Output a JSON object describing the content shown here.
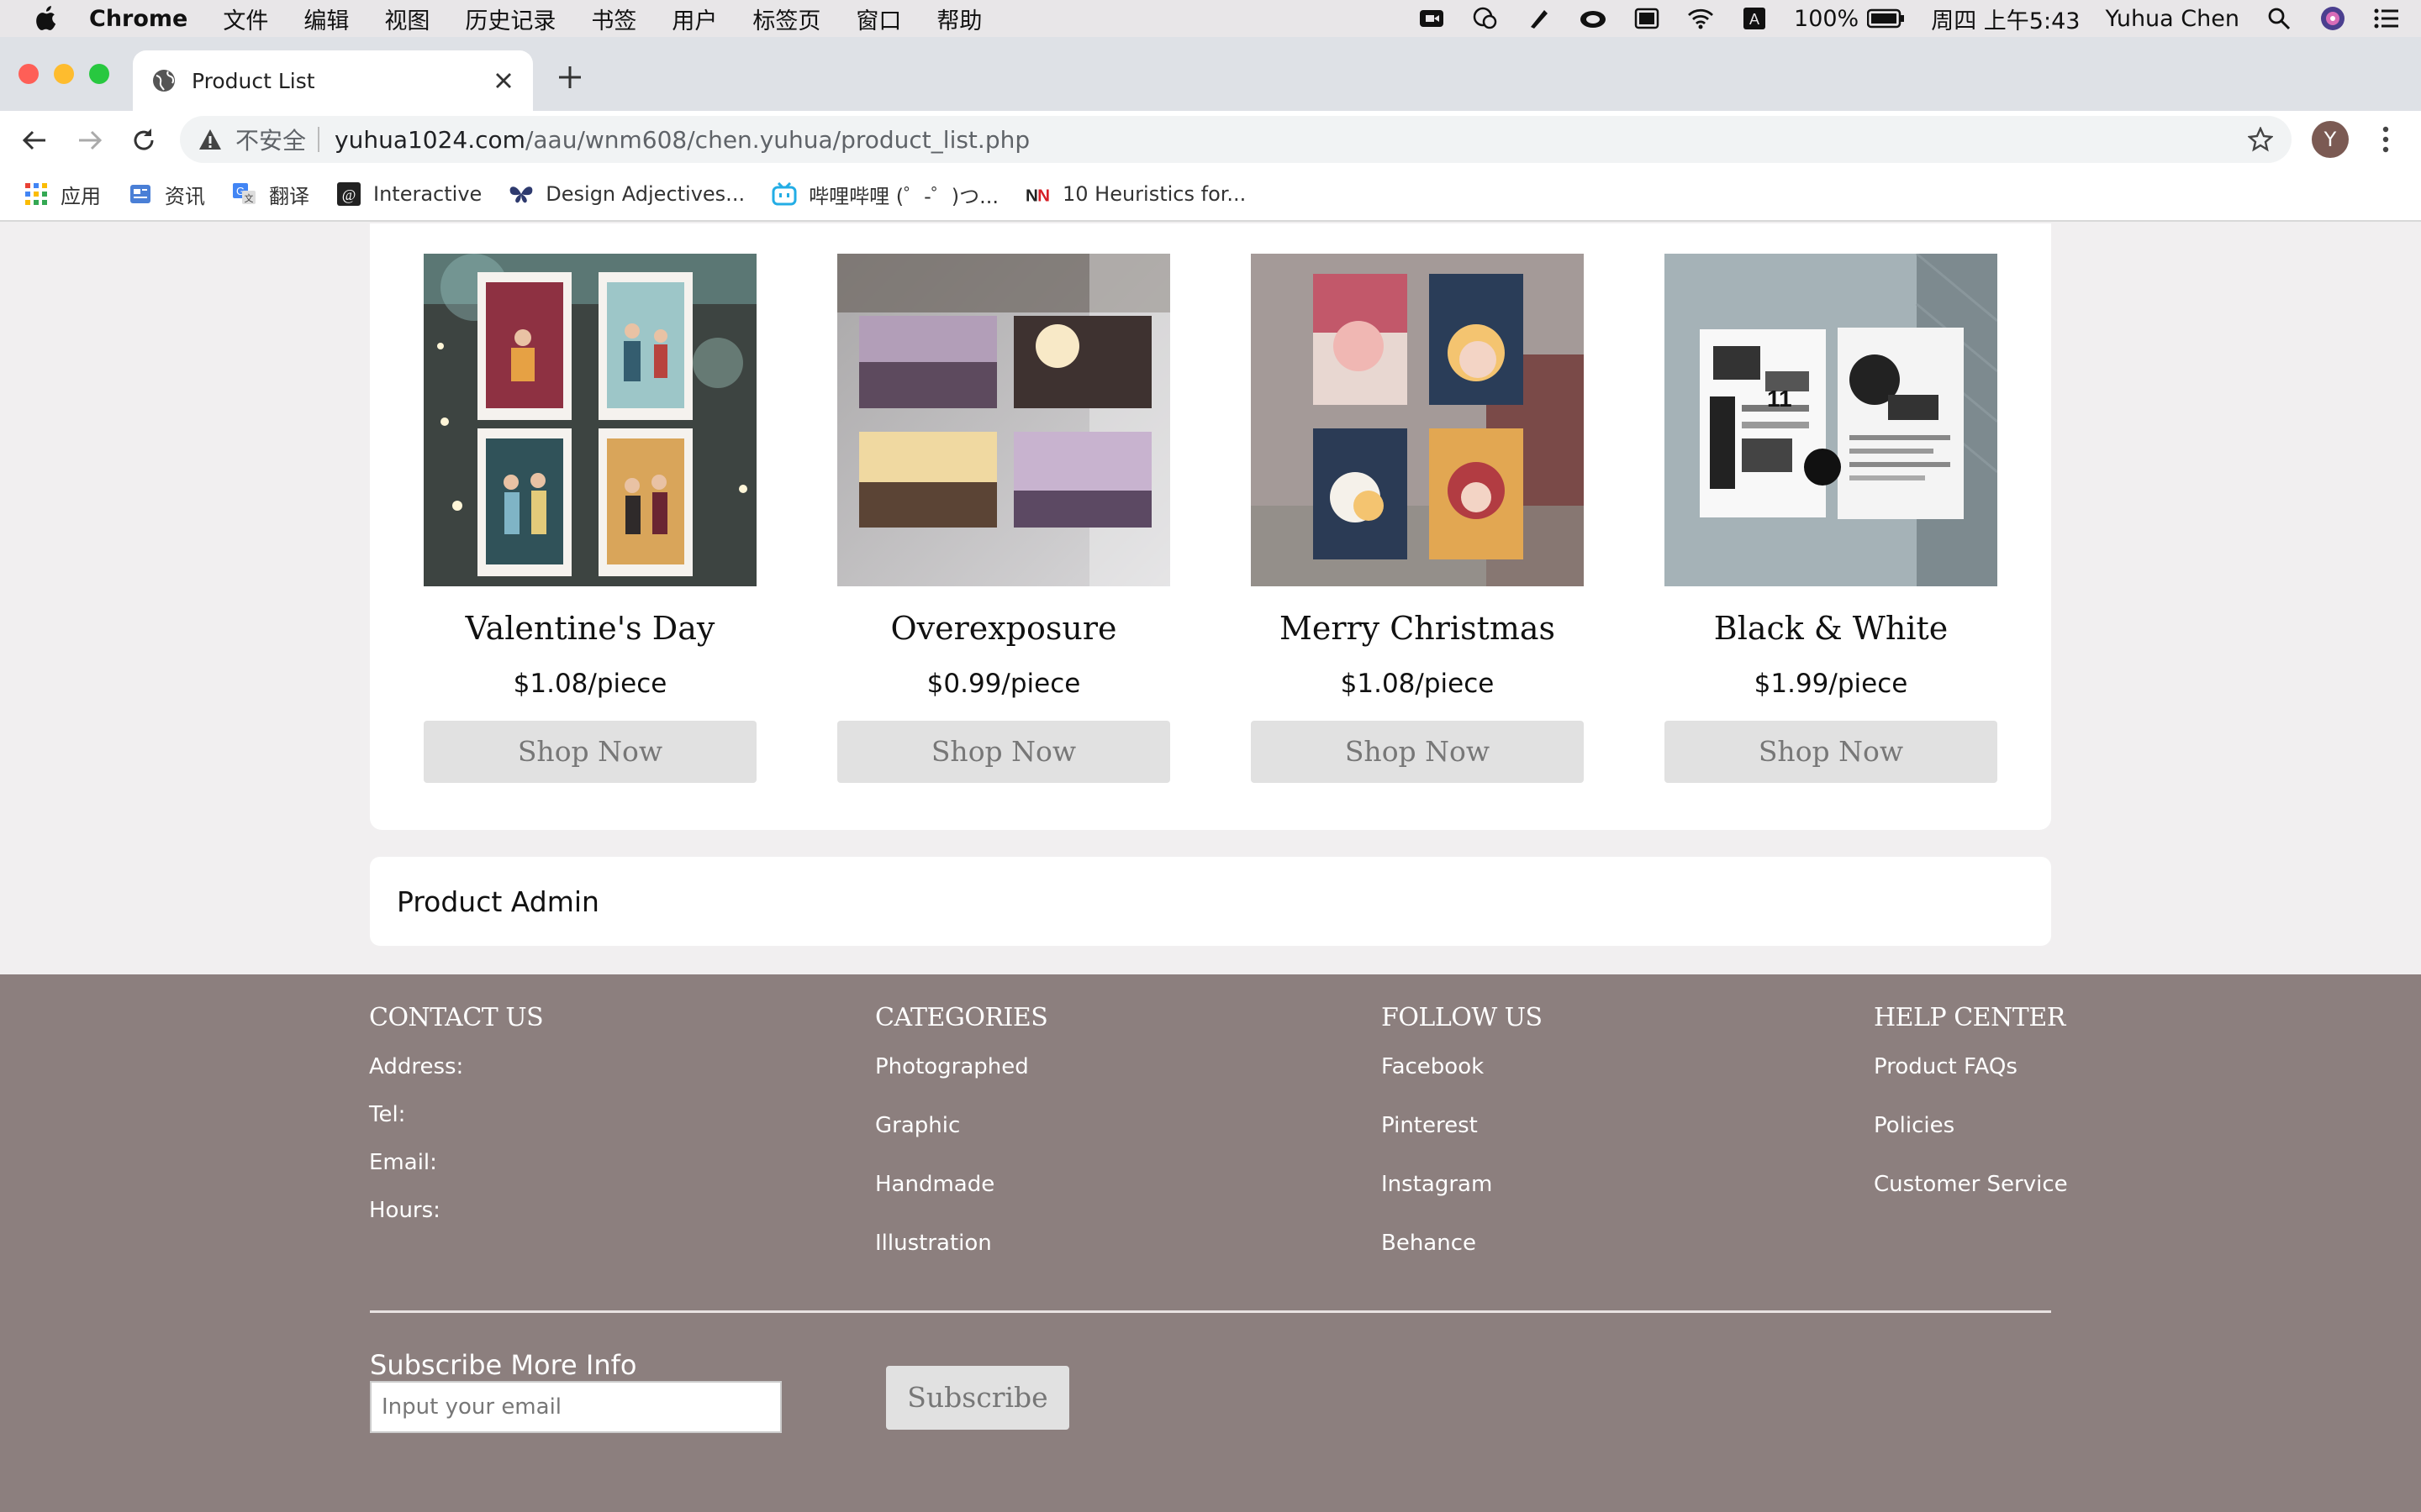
{
  "menubar": {
    "app": "Chrome",
    "items": [
      "文件",
      "编辑",
      "视图",
      "历史记录",
      "书签",
      "用户",
      "标签页",
      "窗口",
      "帮助"
    ],
    "battery": "100%",
    "datetime": "周四 上午5:43",
    "user": "Yuhua Chen"
  },
  "tab": {
    "title": "Product List"
  },
  "omnibox": {
    "insecure_label": "不安全",
    "host": "yuhua1024.com",
    "path": "/aau/wnm608/chen.yuhua/product_list.php"
  },
  "profile": {
    "initial": "Y"
  },
  "bookmarks": [
    {
      "label": "应用",
      "icon": "apps-grid-icon"
    },
    {
      "label": "资讯",
      "icon": "news-icon"
    },
    {
      "label": "翻译",
      "icon": "translate-icon"
    },
    {
      "label": "Interactive",
      "icon": "interactive-icon"
    },
    {
      "label": "Design Adjectives...",
      "icon": "butterfly-icon"
    },
    {
      "label": "哔哩哔哩 (゜-゜)つ...",
      "icon": "bilibili-icon"
    },
    {
      "label": "10 Heuristics for...",
      "icon": "nn-icon"
    }
  ],
  "products": [
    {
      "name": "Valentine's Day",
      "price": "$1.08/piece",
      "button": "Shop Now"
    },
    {
      "name": "Overexposure",
      "price": "$0.99/piece",
      "button": "Shop Now"
    },
    {
      "name": "Merry Christmas",
      "price": "$1.08/piece",
      "button": "Shop Now"
    },
    {
      "name": "Black & White",
      "price": "$1.99/piece",
      "button": "Shop Now"
    }
  ],
  "admin": {
    "label": "Product Admin"
  },
  "footer": {
    "contact": {
      "heading": "CONTACT US",
      "items": [
        "Address:",
        "Tel:",
        "Email:",
        "Hours:"
      ]
    },
    "categories": {
      "heading": "CATEGORIES",
      "items": [
        "Photographed",
        "Graphic",
        "Handmade",
        "Illustration"
      ]
    },
    "follow": {
      "heading": "FOLLOW US",
      "items": [
        "Facebook",
        "Pinterest",
        "Instagram",
        "Behance"
      ]
    },
    "help": {
      "heading": "HELP CENTER",
      "items": [
        "Product FAQs",
        "Policies",
        "Customer Service"
      ]
    },
    "subscribe": {
      "label": "Subscribe More Info",
      "placeholder": "Input your email",
      "button": "Subscribe"
    }
  },
  "colors": {
    "footer_bg": "#8c7f7e",
    "page_bg": "#f1eff0",
    "button_bg": "#e1e1e1"
  }
}
